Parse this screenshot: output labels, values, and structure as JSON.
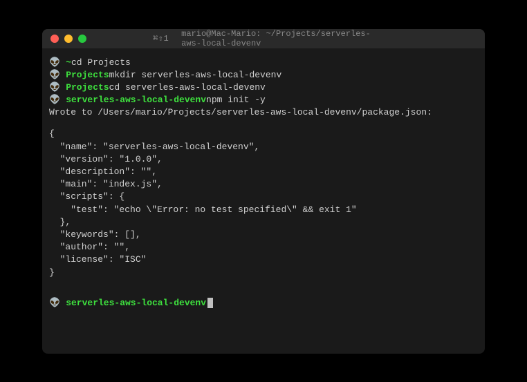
{
  "titlebar": {
    "keys": "⌘⇧1",
    "title": "mario@Mac-Mario: ~/Projects/serverles-aws-local-devenv"
  },
  "lines": {
    "l0_path": "~",
    "l0_cmd": "  cd Projects",
    "l1_path": "Projects",
    "l1_cmd": "  mkdir serverles-aws-local-devenv",
    "l2_path": "Projects",
    "l2_cmd": "  cd serverles-aws-local-devenv",
    "l3_path": "serverles-aws-local-devenv",
    "l3_cmd": "  npm init -y",
    "wrote": "Wrote to /Users/mario/Projects/serverles-aws-local-devenv/package.json:",
    "j0": "{",
    "j1": "  \"name\": \"serverles-aws-local-devenv\",",
    "j2": "  \"version\": \"1.0.0\",",
    "j3": "  \"description\": \"\",",
    "j4": "  \"main\": \"index.js\",",
    "j5": "  \"scripts\": {",
    "j6": "    \"test\": \"echo \\\"Error: no test specified\\\" && exit 1\"",
    "j7": "  },",
    "j8": "  \"keywords\": [],",
    "j9": "  \"author\": \"\",",
    "j10": "  \"license\": \"ISC\"",
    "j11": "}",
    "prompt_path": "serverles-aws-local-devenv",
    "prompt_space": "  "
  }
}
